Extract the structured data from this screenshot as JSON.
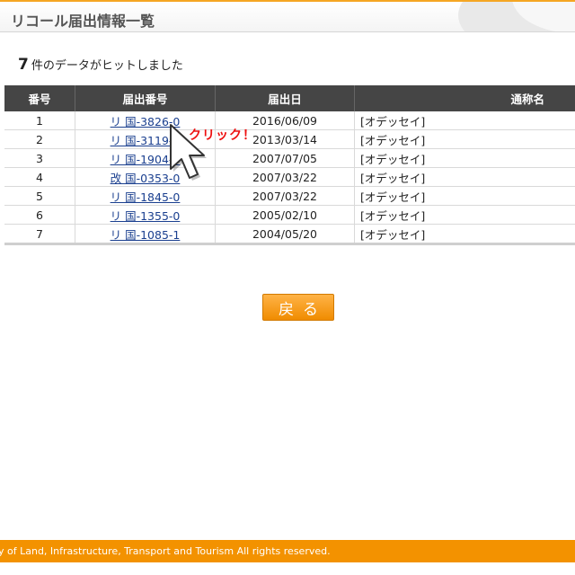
{
  "header": {
    "title": "リコール届出情報一覧"
  },
  "summary": {
    "count": "7",
    "text": "件のデータがヒットしました"
  },
  "table": {
    "headers": [
      "番号",
      "届出番号",
      "届出日",
      "通称名"
    ],
    "rows": [
      {
        "no": "1",
        "id": "リ 国-3826-0",
        "date": "2016/06/09",
        "name": "[オデッセイ]"
      },
      {
        "no": "2",
        "id": "リ 国-3119-0",
        "date": "2013/03/14",
        "name": "[オデッセイ]"
      },
      {
        "no": "3",
        "id": "リ 国-1904-0",
        "date": "2007/07/05",
        "name": "[オデッセイ]"
      },
      {
        "no": "4",
        "id": "改 国-0353-0",
        "date": "2007/03/22",
        "name": "[オデッセイ]"
      },
      {
        "no": "5",
        "id": "リ 国-1845-0",
        "date": "2007/03/22",
        "name": "[オデッセイ]"
      },
      {
        "no": "6",
        "id": "リ 国-1355-0",
        "date": "2005/02/10",
        "name": "[オデッセイ]"
      },
      {
        "no": "7",
        "id": "リ 国-1085-1",
        "date": "2004/05/20",
        "name": "[オデッセイ]"
      }
    ]
  },
  "annotation": {
    "text": "クリック！",
    "icon": "pointer-cursor-icon"
  },
  "actions": {
    "back_label": "戻る"
  },
  "footer": {
    "text": "y of Land, Infrastructure, Transport and Tourism All rights reserved."
  },
  "colors": {
    "accent": "#f39200",
    "header_bg": "#454545",
    "link": "#1a3f8f",
    "annotation": "#ee1111"
  }
}
